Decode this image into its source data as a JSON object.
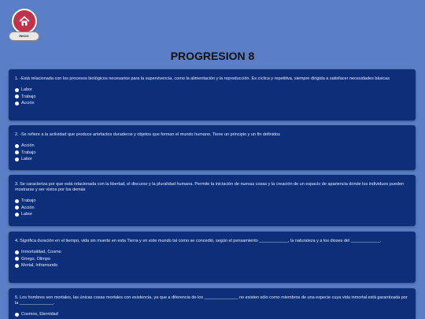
{
  "nav": {
    "home_label": "INICIO"
  },
  "page": {
    "title": "PROGRESION 8"
  },
  "colors": {
    "background": "#5b7fc6",
    "card": "#0d2f7a",
    "home_icon": "#c0334a"
  },
  "questions": [
    {
      "text": "1. -Está relacionada con los procesos biológicos necesarios para la supervivencia, como la alimentación y la reproducción. Es cíclica y repetitiva, siempre dirigida a satisfacer necesidades básicas",
      "options": [
        "Labor",
        "Trabajo",
        "Acción"
      ]
    },
    {
      "text": "2. -Se refiere a la actividad que produce artefactos duraderos y objetos que forman el mundo humano. Tiene un principio y un fin definidos",
      "options": [
        "Acción",
        "Trabajo",
        "Labor"
      ]
    },
    {
      "text": "3. Se caracteriza por que está relacionada con la libertad, el discurso y la pluralidad humana. Permite la iniciación de nuevas cosas y la creación de un espacio de apariencia donde los individuos pueden mostrarse y ser vistos por los demás",
      "options": [
        "Trabajo",
        "Acción",
        "Labor"
      ]
    },
    {
      "text": "4. Significa duración en el tiempo, vida sin muerte en esta Tierra y en este mundo tal como se concedió, según el pensamiento ____________, la naturaleza y a los dioses del ____________.",
      "options": [
        "Inmortalidad, Cosmo",
        "Griego, Olimpo",
        "Mortal, Inframundo"
      ]
    },
    {
      "text": "5. Los hombres son mortales, las únicas cosas mortales con existencia, ya que a diferencia de los ______________ no existen sólo como miembros de una especie cuya vida inmortal está garantizada por la ______________.",
      "options": [
        "Cosmos, Eternidad"
      ]
    }
  ]
}
